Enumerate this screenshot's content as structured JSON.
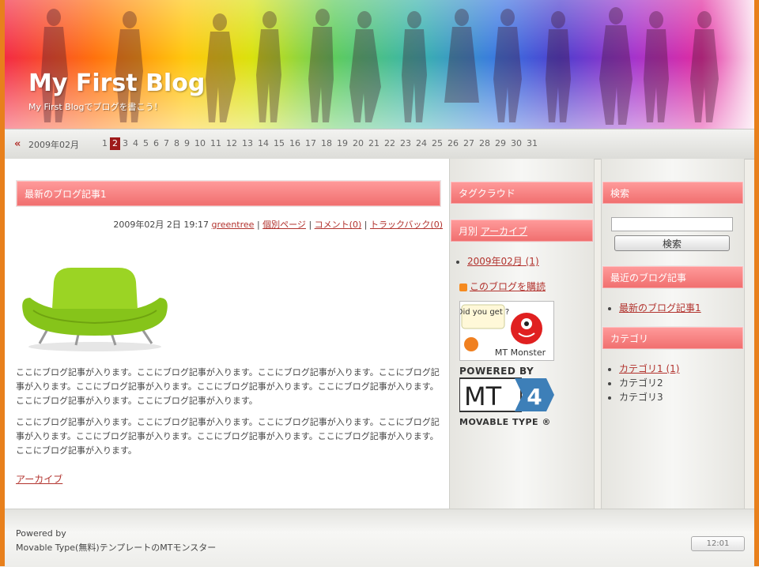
{
  "header": {
    "title": "My First Blog",
    "description": "My First Blogでブログを書こう！"
  },
  "calendar": {
    "prev_symbol": "«",
    "month": "2009年02月",
    "days": [
      "1",
      "2",
      "3",
      "4",
      "5",
      "6",
      "7",
      "8",
      "9",
      "10",
      "11",
      "12",
      "13",
      "14",
      "15",
      "16",
      "17",
      "18",
      "19",
      "20",
      "21",
      "22",
      "23",
      "24",
      "25",
      "26",
      "27",
      "28",
      "29",
      "30",
      "31"
    ],
    "active_day": "2"
  },
  "entry": {
    "title": "最新のブログ記事1",
    "date": "2009年02月 2日 19:17",
    "author": "greentree",
    "permalink": "個別ページ",
    "comments": "コメント(0)",
    "trackbacks": "トラックバック(0)",
    "separator": "|",
    "paragraph1": "ここにブログ記事が入ります。ここにブログ記事が入ります。ここにブログ記事が入ります。ここにブログ記事が入ります。ここにブログ記事が入ります。ここにブログ記事が入ります。ここにブログ記事が入ります。ここにブログ記事が入ります。ここにブログ記事が入ります。",
    "paragraph2": "ここにブログ記事が入ります。ここにブログ記事が入ります。ここにブログ記事が入ります。ここにブログ記事が入ります。ここにブログ記事が入ります。ここにブログ記事が入ります。ここにブログ記事が入ります。ここにブログ記事が入ります。",
    "archive_link": "アーカイブ"
  },
  "sidebar1": {
    "tagcloud_title": "タグクラウド",
    "monthly_prefix": "月別",
    "monthly_link": "アーカイブ",
    "archives": [
      "2009年02月 (1)"
    ],
    "subscribe": "このブログを購読",
    "monster_badge": "Did you get ?",
    "monster_name": "MT Monster",
    "powered_by": "POWERED BY",
    "mt_logo": "MT",
    "mt_version": "4",
    "mt_name": "MOVABLE TYPE ®"
  },
  "sidebar2": {
    "search_title": "検索",
    "search_button": "検索",
    "search_value": "",
    "recent_title": "最近のブログ記事",
    "recent_items": [
      "最新のブログ記事1"
    ],
    "category_title": "カテゴリ",
    "categories": [
      {
        "label": "カテゴリ1 (1)",
        "link": true
      },
      {
        "label": "カテゴリ2",
        "link": false
      },
      {
        "label": "カテゴリ3",
        "link": false
      }
    ]
  },
  "footer": {
    "line1": "Powered by",
    "line2": "Movable Type(無料)テンプレートのMTモンスター",
    "clock": "12:01"
  },
  "colors": {
    "accent": "#b2332e",
    "heading_pink": "#f06e6e",
    "frame_orange": "#e8801c"
  }
}
